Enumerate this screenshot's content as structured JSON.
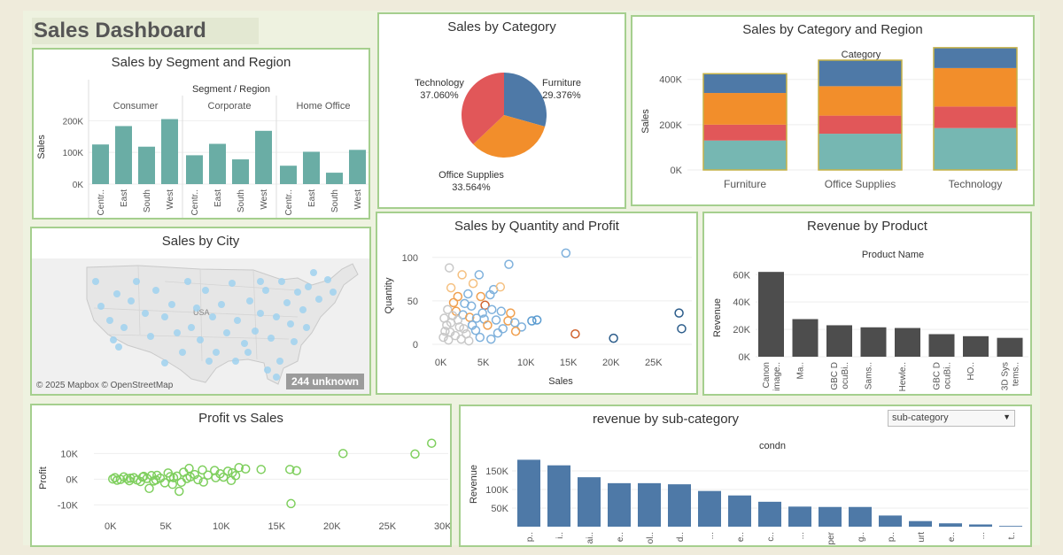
{
  "dashboard": {
    "title": "Sales Dashboard"
  },
  "panels": {
    "segment": {
      "title": "Sales by Segment and Region",
      "header": "Segment  /  Region",
      "ylabel": "Sales"
    },
    "category": {
      "title": "Sales by Category"
    },
    "catRegion": {
      "title": "Sales by Category and Region",
      "header": "Category",
      "ylabel": "Sales"
    },
    "city": {
      "title": "Sales by City",
      "credit": "© 2025 Mapbox © OpenStreetMap",
      "map_label": "USA",
      "unknown": "244 unknown"
    },
    "qtyProfit": {
      "title": "Sales by Quantity and Profit",
      "xlabel": "Sales",
      "ylabel": "Quantity"
    },
    "product": {
      "title": "Revenue by Product",
      "header": "Product Name",
      "ylabel": "Revenue"
    },
    "profitSales": {
      "title": "Profit vs Sales",
      "ylabel": "Profit"
    },
    "subcat": {
      "title": "revenue by sub-category",
      "header": "condn",
      "ylabel": "Revenue",
      "dropdown_value": "sub-category"
    }
  },
  "colors": {
    "teal": "#6aada5",
    "blue": "#4e79a7",
    "orange": "#f28e2b",
    "red": "#e15759",
    "tealLight": "#76b7b2",
    "dark": "#4d4d4d",
    "green": "#7fcf5e",
    "border": "#a5cf8e"
  },
  "chart_data": [
    {
      "id": "segment",
      "type": "bar",
      "title": "Sales by Segment and Region",
      "ylabel": "Sales",
      "yticks": [
        0,
        100000,
        200000
      ],
      "ytick_labels": [
        "0K",
        "100K",
        "200K"
      ],
      "ylim": [
        0,
        240000
      ],
      "groups": [
        {
          "name": "Consumer",
          "categories": [
            "Centr..",
            "East",
            "South",
            "West"
          ],
          "values": [
            125000,
            183000,
            118000,
            205000
          ]
        },
        {
          "name": "Corporate",
          "categories": [
            "Centr..",
            "East",
            "South",
            "West"
          ],
          "values": [
            91000,
            127000,
            78000,
            168000
          ]
        },
        {
          "name": "Home Office",
          "categories": [
            "Centr..",
            "East",
            "South",
            "West"
          ],
          "values": [
            58000,
            102000,
            36000,
            108000
          ]
        }
      ]
    },
    {
      "id": "category",
      "type": "pie",
      "title": "Sales by Category",
      "slices": [
        {
          "label": "Furniture",
          "pct": "29.376%",
          "value": 29.376,
          "color": "#4e79a7"
        },
        {
          "label": "Office Supplies",
          "pct": "33.564%",
          "value": 33.564,
          "color": "#f28e2b"
        },
        {
          "label": "Technology",
          "pct": "37.060%",
          "value": 37.06,
          "color": "#e15759"
        }
      ]
    },
    {
      "id": "catRegion",
      "type": "bar",
      "title": "Sales by Category and Region",
      "ylabel": "Sales",
      "stacked": true,
      "categories": [
        "Furniture",
        "Office Supplies",
        "Technology"
      ],
      "yticks": [
        0,
        200000,
        400000
      ],
      "ytick_labels": [
        "0K",
        "200K",
        "400K"
      ],
      "ylim": [
        0,
        520000
      ],
      "series": [
        {
          "color": "#76b7b2",
          "values": [
            130000,
            160000,
            185000
          ]
        },
        {
          "color": "#e15759",
          "values": [
            70000,
            80000,
            95000
          ]
        },
        {
          "color": "#f28e2b",
          "values": [
            140000,
            130000,
            170000
          ]
        },
        {
          "color": "#4e79a7",
          "values": [
            85000,
            115000,
            90000
          ]
        }
      ]
    },
    {
      "id": "qtyProfit",
      "type": "scatter",
      "title": "Sales by Quantity and Profit",
      "xlabel": "Sales",
      "ylabel": "Quantity",
      "xticks": [
        0,
        5000,
        10000,
        15000,
        20000,
        25000
      ],
      "xtick_labels": [
        "0K",
        "5K",
        "10K",
        "15K",
        "20K",
        "25K"
      ],
      "yticks": [
        0,
        50,
        100
      ],
      "ytick_labels": [
        "0",
        "50",
        "100"
      ],
      "xlim": [
        -1000,
        29500
      ],
      "ylim": [
        0,
        112
      ],
      "points": [
        {
          "x": 14700,
          "y": 105,
          "c": "#7fb1dc"
        },
        {
          "x": 8000,
          "y": 92,
          "c": "#7fb1dc"
        },
        {
          "x": 28000,
          "y": 36,
          "c": "#2b5c8a"
        },
        {
          "x": 28300,
          "y": 18,
          "c": "#2b5c8a"
        },
        {
          "x": 20300,
          "y": 7,
          "c": "#2b5c8a"
        },
        {
          "x": 15800,
          "y": 12,
          "c": "#d0632e"
        },
        {
          "x": 5200,
          "y": 45,
          "c": "#d0632e"
        },
        {
          "x": 11300,
          "y": 28,
          "c": "#5a9bd0"
        },
        {
          "x": 10700,
          "y": 27,
          "c": "#5a9bd0"
        },
        {
          "x": 1000,
          "y": 88,
          "c": "#c8c8c8"
        },
        {
          "x": 2500,
          "y": 80,
          "c": "#f5c080"
        },
        {
          "x": 4500,
          "y": 80,
          "c": "#7fb1dc"
        },
        {
          "x": 1200,
          "y": 65,
          "c": "#f5c080"
        },
        {
          "x": 3800,
          "y": 70,
          "c": "#f5c080"
        },
        {
          "x": 6200,
          "y": 63,
          "c": "#7fb1dc"
        },
        {
          "x": 7000,
          "y": 66,
          "c": "#f5c080"
        },
        {
          "x": 2000,
          "y": 55,
          "c": "#f0a050"
        },
        {
          "x": 3200,
          "y": 58,
          "c": "#7fb1dc"
        },
        {
          "x": 4700,
          "y": 55,
          "c": "#f0a050"
        },
        {
          "x": 5800,
          "y": 57,
          "c": "#7fb1dc"
        },
        {
          "x": 1500,
          "y": 48,
          "c": "#f0a050"
        },
        {
          "x": 2800,
          "y": 47,
          "c": "#7fb1dc"
        },
        {
          "x": 3600,
          "y": 44,
          "c": "#7fb1dc"
        },
        {
          "x": 6000,
          "y": 40,
          "c": "#7fb1dc"
        },
        {
          "x": 7100,
          "y": 38,
          "c": "#7fb1dc"
        },
        {
          "x": 8200,
          "y": 36,
          "c": "#f0a050"
        },
        {
          "x": 800,
          "y": 40,
          "c": "#c8c8c8"
        },
        {
          "x": 1800,
          "y": 38,
          "c": "#f0a050"
        },
        {
          "x": 2600,
          "y": 34,
          "c": "#7fb1dc"
        },
        {
          "x": 3400,
          "y": 31,
          "c": "#f0a050"
        },
        {
          "x": 4200,
          "y": 30,
          "c": "#7fb1dc"
        },
        {
          "x": 5100,
          "y": 29,
          "c": "#7fb1dc"
        },
        {
          "x": 6500,
          "y": 28,
          "c": "#7fb1dc"
        },
        {
          "x": 7900,
          "y": 27,
          "c": "#f0a050"
        },
        {
          "x": 8700,
          "y": 25,
          "c": "#7fb1dc"
        },
        {
          "x": 9500,
          "y": 20,
          "c": "#7fb1dc"
        },
        {
          "x": 5500,
          "y": 22,
          "c": "#f0a050"
        },
        {
          "x": 7300,
          "y": 18,
          "c": "#7fb1dc"
        },
        {
          "x": 8800,
          "y": 15,
          "c": "#f0a050"
        },
        {
          "x": 6700,
          "y": 13,
          "c": "#7fb1dc"
        },
        {
          "x": 4100,
          "y": 16,
          "c": "#7fb1dc"
        },
        {
          "x": 3000,
          "y": 12,
          "c": "#c8c8c8"
        },
        {
          "x": 2200,
          "y": 20,
          "c": "#c8c8c8"
        },
        {
          "x": 1200,
          "y": 25,
          "c": "#c8c8c8"
        },
        {
          "x": 500,
          "y": 15,
          "c": "#c8c8c8"
        },
        {
          "x": 1700,
          "y": 10,
          "c": "#c8c8c8"
        },
        {
          "x": 2400,
          "y": 6,
          "c": "#c8c8c8"
        },
        {
          "x": 3300,
          "y": 4,
          "c": "#c8c8c8"
        },
        {
          "x": 900,
          "y": 5,
          "c": "#c8c8c8"
        },
        {
          "x": 4600,
          "y": 8,
          "c": "#7fb1dc"
        },
        {
          "x": 5900,
          "y": 6,
          "c": "#7fb1dc"
        },
        {
          "x": 400,
          "y": 30,
          "c": "#c8c8c8"
        },
        {
          "x": 1400,
          "y": 33,
          "c": "#c8c8c8"
        },
        {
          "x": 700,
          "y": 22,
          "c": "#c8c8c8"
        },
        {
          "x": 2000,
          "y": 28,
          "c": "#c8c8c8"
        },
        {
          "x": 300,
          "y": 8,
          "c": "#c8c8c8"
        },
        {
          "x": 1100,
          "y": 14,
          "c": "#c8c8c8"
        },
        {
          "x": 2700,
          "y": 18,
          "c": "#c8c8c8"
        },
        {
          "x": 3700,
          "y": 22,
          "c": "#7fb1dc"
        },
        {
          "x": 4900,
          "y": 36,
          "c": "#7fb1dc"
        }
      ]
    },
    {
      "id": "product",
      "type": "bar",
      "title": "Revenue by Product",
      "ylabel": "Revenue",
      "categories": [
        "Canon image..",
        "Ma..",
        "GBC D ocuBi..",
        "Sams..",
        "Hewle..",
        "GBC D ocuBi..",
        "HO..",
        "3D Sys tems.."
      ],
      "values": [
        62000,
        27500,
        23000,
        21500,
        21000,
        16500,
        15000,
        13800
      ],
      "yticks": [
        0,
        20000,
        40000,
        60000
      ],
      "ytick_labels": [
        "0K",
        "20K",
        "40K",
        "60K"
      ],
      "ylim": [
        0,
        66000
      ]
    },
    {
      "id": "profitSales",
      "type": "scatter",
      "title": "Profit vs Sales",
      "ylabel": "Profit",
      "xticks": [
        0,
        5000,
        10000,
        15000,
        20000,
        25000,
        30000
      ],
      "xtick_labels": [
        "0K",
        "5K",
        "10K",
        "15K",
        "20K",
        "25K",
        "30K"
      ],
      "yticks": [
        -10000,
        0,
        10000
      ],
      "ytick_labels": [
        "-10K",
        "0K",
        "10K"
      ],
      "xlim": [
        -1500,
        30500
      ],
      "ylim": [
        -14000,
        17000
      ],
      "points": [
        [
          29000,
          14000
        ],
        [
          27500,
          9800
        ],
        [
          21000,
          10000
        ],
        [
          16200,
          3800
        ],
        [
          16800,
          3300
        ],
        [
          16300,
          -9500
        ],
        [
          13600,
          3800
        ],
        [
          11600,
          4500
        ],
        [
          12200,
          4000
        ],
        [
          11000,
          2500
        ],
        [
          10200,
          800
        ],
        [
          9500,
          600
        ],
        [
          10900,
          -500
        ],
        [
          8400,
          -1100
        ],
        [
          6200,
          -4700
        ],
        [
          3500,
          -3600
        ],
        [
          5600,
          -2000
        ],
        [
          4200,
          1500
        ],
        [
          7100,
          4200
        ],
        [
          8300,
          3600
        ],
        [
          9400,
          3400
        ],
        [
          7600,
          1800
        ],
        [
          6000,
          1200
        ],
        [
          5200,
          2400
        ],
        [
          4500,
          400
        ],
        [
          3900,
          -700
        ],
        [
          3000,
          1100
        ],
        [
          2400,
          -300
        ],
        [
          1800,
          400
        ],
        [
          1200,
          900
        ],
        [
          600,
          -400
        ],
        [
          200,
          100
        ],
        [
          900,
          -100
        ],
        [
          1500,
          200
        ],
        [
          2100,
          600
        ],
        [
          2700,
          -900
        ],
        [
          3300,
          300
        ],
        [
          3700,
          1400
        ],
        [
          4900,
          -1400
        ],
        [
          5700,
          600
        ],
        [
          6600,
          2700
        ],
        [
          7200,
          900
        ],
        [
          7900,
          -200
        ],
        [
          8800,
          1600
        ],
        [
          9900,
          2100
        ],
        [
          10600,
          3100
        ],
        [
          11300,
          1400
        ],
        [
          400,
          600
        ],
        [
          1700,
          -600
        ],
        [
          2900,
          800
        ],
        [
          4100,
          -300
        ],
        [
          5400,
          1000
        ],
        [
          6400,
          -1200
        ],
        [
          6900,
          300
        ]
      ]
    },
    {
      "id": "subcat",
      "type": "bar",
      "title": "revenue by sub-category",
      "ylabel": "Revenue",
      "categories": [
        "p..",
        "i..",
        "ai..",
        "e..",
        "ol..",
        "d..",
        "...",
        "e..",
        "c..",
        "...",
        "per",
        "g..",
        "p..",
        "urt",
        "e..",
        "...",
        "t.."
      ],
      "values": [
        180000,
        165000,
        133000,
        117000,
        117000,
        114000,
        96000,
        84000,
        67000,
        54000,
        53000,
        53000,
        30000,
        15000,
        9000,
        6000,
        2000
      ],
      "yticks": [
        50000,
        100000,
        150000
      ],
      "ytick_labels": [
        "50K",
        "100K",
        "150K"
      ],
      "ylim": [
        0,
        200000
      ]
    }
  ]
}
